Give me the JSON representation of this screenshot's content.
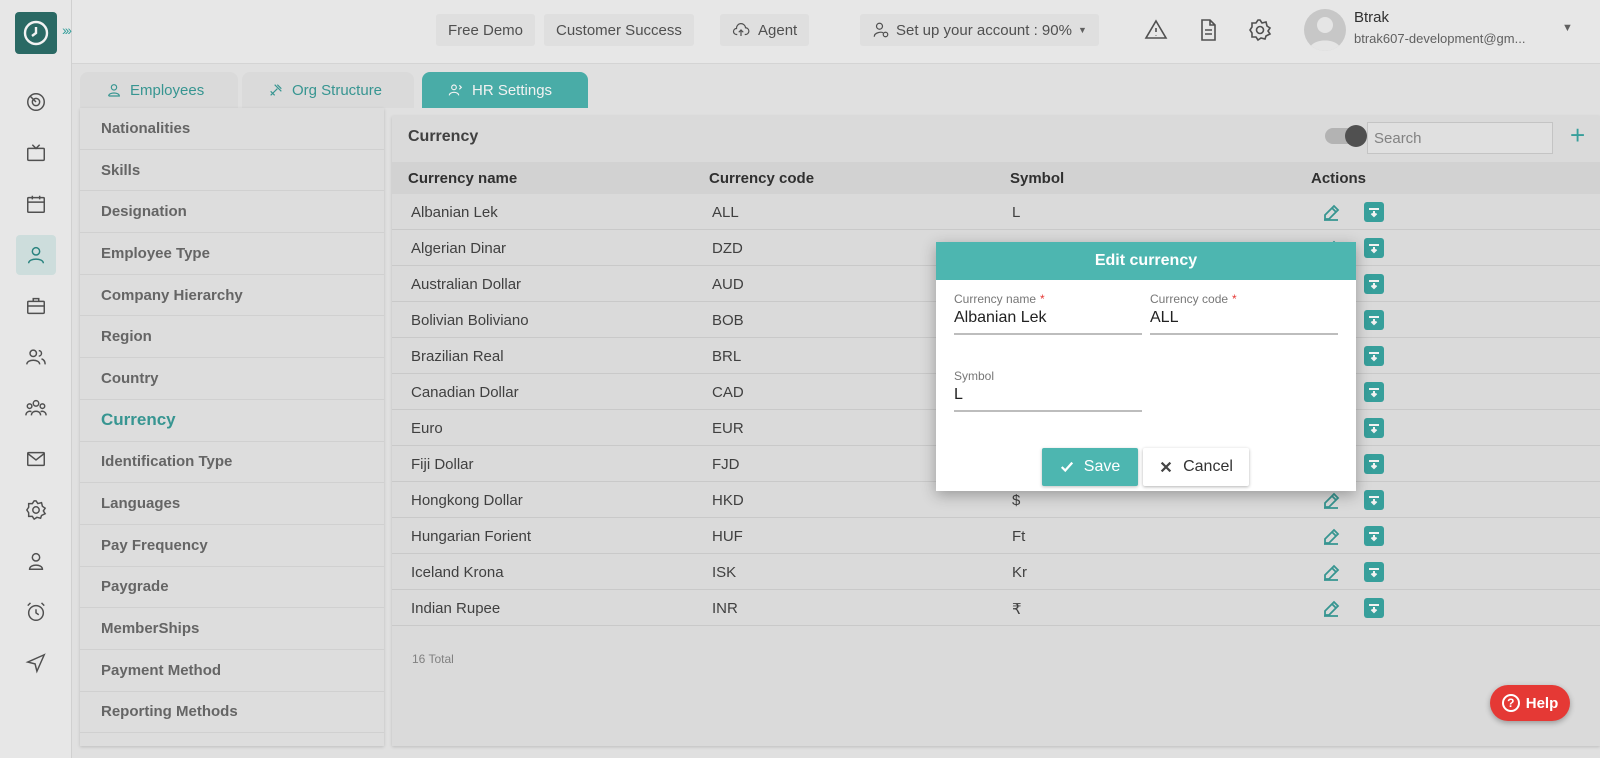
{
  "topbar": {
    "free_demo": "Free Demo",
    "customer_success": "Customer Success",
    "agent": "Agent",
    "setup_account": "Set up your account : 90%",
    "user_name": "Btrak",
    "user_email": "btrak607-development@gm..."
  },
  "tabs": {
    "employees": "Employees",
    "org_structure": "Org Structure",
    "hr_settings": "HR Settings"
  },
  "settings_menu": [
    "Nationalities",
    "Skills",
    "Designation",
    "Employee Type",
    "Company Hierarchy",
    "Region",
    "Country",
    "Currency",
    "Identification Type",
    "Languages",
    "Pay Frequency",
    "Paygrade",
    "MemberShips",
    "Payment Method",
    "Reporting Methods"
  ],
  "active_setting": "Currency",
  "currency_panel": {
    "title": "Currency",
    "search_placeholder": "Search",
    "columns": {
      "name": "Currency name",
      "code": "Currency code",
      "symbol": "Symbol",
      "actions": "Actions"
    },
    "rows": [
      {
        "name": "Albanian Lek",
        "code": "ALL",
        "symbol": "L"
      },
      {
        "name": "Algerian Dinar",
        "code": "DZD",
        "symbol": ""
      },
      {
        "name": "Australian Dollar",
        "code": "AUD",
        "symbol": ""
      },
      {
        "name": "Bolivian Boliviano",
        "code": "BOB",
        "symbol": ""
      },
      {
        "name": "Brazilian Real",
        "code": "BRL",
        "symbol": ""
      },
      {
        "name": "Canadian Dollar",
        "code": "CAD",
        "symbol": ""
      },
      {
        "name": "Euro",
        "code": "EUR",
        "symbol": ""
      },
      {
        "name": "Fiji Dollar",
        "code": "FJD",
        "symbol": ""
      },
      {
        "name": "Hongkong Dollar",
        "code": "HKD",
        "symbol": "$"
      },
      {
        "name": "Hungarian Forient",
        "code": "HUF",
        "symbol": "Ft"
      },
      {
        "name": "Iceland Krona",
        "code": "ISK",
        "symbol": "Kr"
      },
      {
        "name": "Indian Rupee",
        "code": "INR",
        "symbol": "₹"
      }
    ],
    "total": "16 Total"
  },
  "modal": {
    "title": "Edit currency",
    "name_label": "Currency name",
    "name_value": "Albanian Lek",
    "code_label": "Currency code",
    "code_value": "ALL",
    "symbol_label": "Symbol",
    "symbol_value": "L",
    "required_mark": "*",
    "save": "Save",
    "cancel": "Cancel"
  },
  "help": {
    "label": "Help",
    "icon_glyph": "?"
  },
  "colors": {
    "accent": "#4db6b0",
    "help": "#e53935"
  }
}
